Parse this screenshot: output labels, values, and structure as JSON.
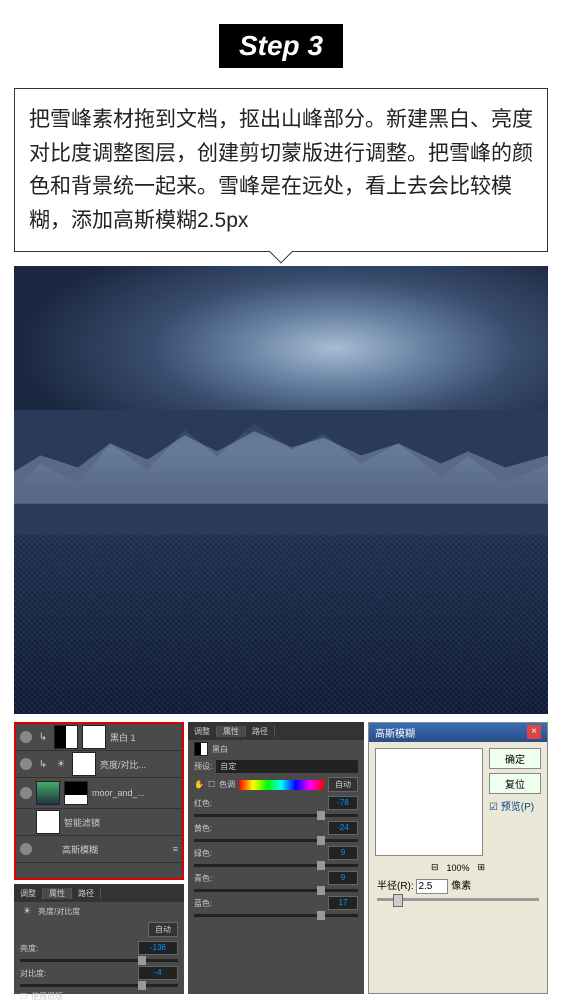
{
  "step": {
    "label": "Step 3"
  },
  "description": "把雪峰素材拖到文档，抠出山峰部分。新建黑白、亮度对比度调整图层，创建剪切蒙版进行调整。把雪峰的颜色和背景统一起来。雪峰是在远处，看上去会比较模糊，添加高斯模糊2.5px",
  "layers": {
    "items": [
      {
        "name": "黑白 1"
      },
      {
        "name": "亮度/对比..."
      },
      {
        "name": "moor_and_..."
      },
      {
        "name": "智能滤镜"
      },
      {
        "name": "高斯模糊"
      }
    ]
  },
  "props_bw": {
    "tabs": [
      "调整",
      "属性",
      "路径"
    ],
    "title": "黑白",
    "preset_label": "预设:",
    "preset_value": "自定",
    "tint_label": "色调",
    "sliders": [
      {
        "label": "红色:",
        "value": "-78"
      },
      {
        "label": "黄色:",
        "value": "-24"
      },
      {
        "label": "绿色:",
        "value": "9"
      },
      {
        "label": "青色:",
        "value": "9"
      },
      {
        "label": "蓝色:",
        "value": "17"
      }
    ]
  },
  "bc": {
    "tabs": [
      "调整",
      "属性",
      "路径"
    ],
    "title": "亮度/对比度",
    "auto": "自动",
    "rows": [
      {
        "label": "亮度:",
        "value": "-136"
      },
      {
        "label": "对比度:",
        "value": "-4"
      }
    ],
    "legacy": "使用旧版"
  },
  "gauss": {
    "title": "高斯模糊",
    "ok": "确定",
    "cancel": "复位",
    "preview_chk": "预览(P)",
    "zoom": "100%",
    "radius_label": "半径(R):",
    "radius_value": "2.5",
    "unit": "像素"
  }
}
